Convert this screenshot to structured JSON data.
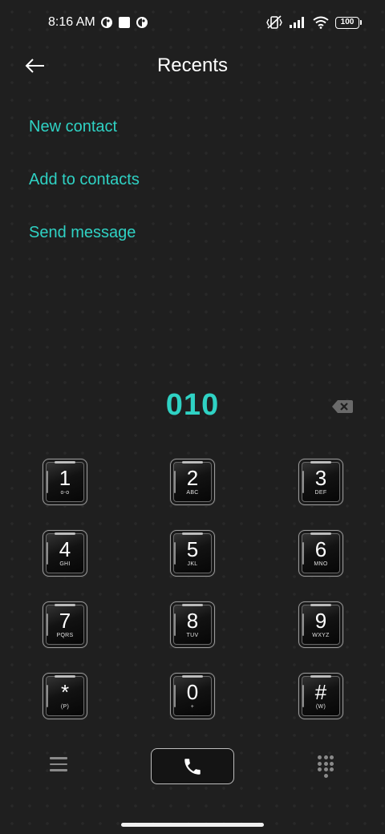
{
  "status_bar": {
    "time": "8:16 AM",
    "battery": "100",
    "icons": [
      "app-notification-icon",
      "square-notification-icon",
      "app-notification-icon",
      "vibrate-off-icon",
      "signal-icon",
      "wifi-icon",
      "battery-icon"
    ]
  },
  "header": {
    "title": "Recents",
    "back_icon": "arrow-left-icon"
  },
  "actions": [
    {
      "label": "New contact"
    },
    {
      "label": "Add to contacts"
    },
    {
      "label": "Send message"
    }
  ],
  "dialer": {
    "number": "010",
    "delete_icon": "backspace-icon"
  },
  "keypad": [
    {
      "digit": "1",
      "letters": "o-o"
    },
    {
      "digit": "2",
      "letters": "ABC"
    },
    {
      "digit": "3",
      "letters": "DEF"
    },
    {
      "digit": "4",
      "letters": "GHI"
    },
    {
      "digit": "5",
      "letters": "JKL"
    },
    {
      "digit": "6",
      "letters": "MNO"
    },
    {
      "digit": "7",
      "letters": "PQRS"
    },
    {
      "digit": "8",
      "letters": "TUV"
    },
    {
      "digit": "9",
      "letters": "WXYZ"
    },
    {
      "digit": "*",
      "letters": "(P)"
    },
    {
      "digit": "0",
      "letters": "+"
    },
    {
      "digit": "#",
      "letters": "(W)"
    }
  ],
  "bottom_bar": {
    "menu_icon": "menu-icon",
    "call_icon": "phone-icon",
    "dialpad_icon": "dialpad-icon"
  },
  "colors": {
    "accent": "#2fd2c4",
    "background": "#1f1f1f"
  }
}
